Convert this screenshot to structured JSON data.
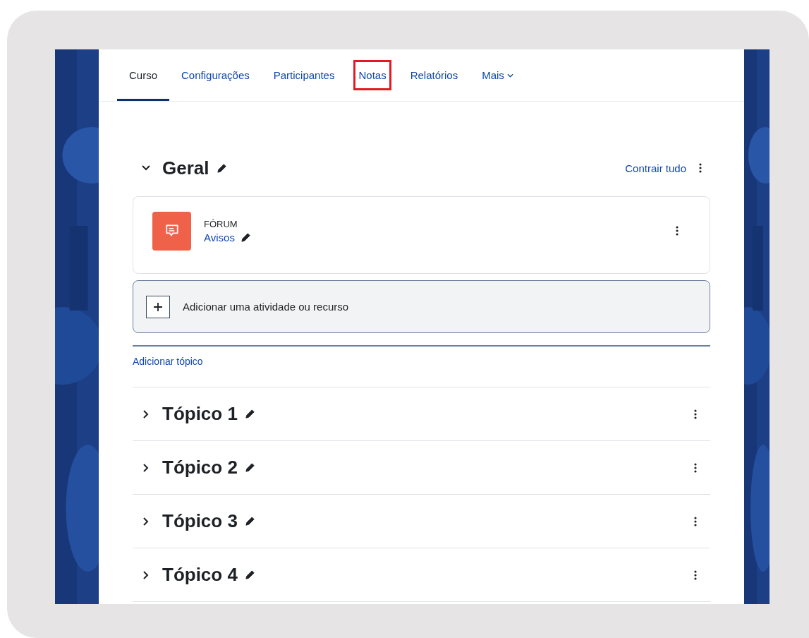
{
  "tabs": [
    {
      "label": "Curso",
      "selected": true,
      "highlighted": false
    },
    {
      "label": "Configurações",
      "selected": false,
      "highlighted": false
    },
    {
      "label": "Participantes",
      "selected": false,
      "highlighted": false
    },
    {
      "label": "Notas",
      "selected": false,
      "highlighted": true
    },
    {
      "label": "Relatórios",
      "selected": false,
      "highlighted": false
    },
    {
      "label": "Mais",
      "selected": false,
      "highlighted": false,
      "dropdown": true
    }
  ],
  "general": {
    "title": "Geral",
    "expanded": true,
    "collapse_all": "Contrair tudo",
    "activities": [
      {
        "type": "FÓRUM",
        "name": "Avisos"
      }
    ],
    "add_activity": "Adicionar uma atividade ou recurso"
  },
  "add_topic": "Adicionar tópico",
  "topics": [
    {
      "title": "Tópico 1",
      "expanded": false
    },
    {
      "title": "Tópico 2",
      "expanded": false
    },
    {
      "title": "Tópico 3",
      "expanded": false
    },
    {
      "title": "Tópico 4",
      "expanded": false
    }
  ]
}
